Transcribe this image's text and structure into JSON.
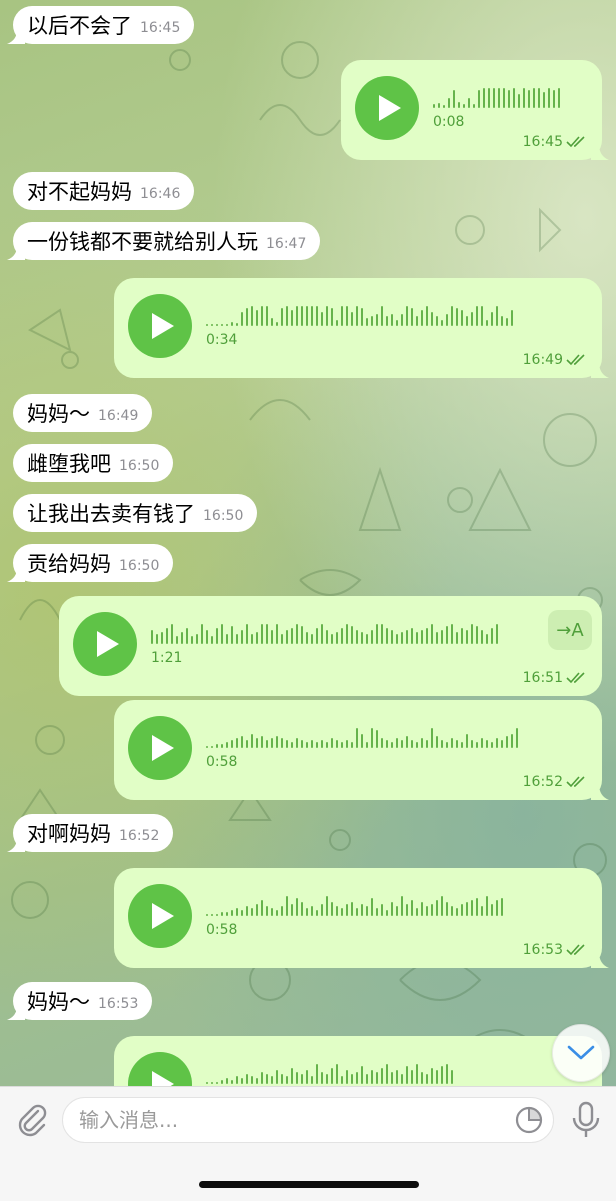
{
  "chat": {
    "incoming": [
      {
        "text": "以后不会了",
        "time": "16:45"
      },
      {
        "text": "对不起妈妈",
        "time": "16:46"
      },
      {
        "text": "一份钱都不要就给别人玩",
        "time": "16:47"
      },
      {
        "text": "妈妈～",
        "time": "16:49"
      },
      {
        "text": "雌堕我吧",
        "time": "16:50"
      },
      {
        "text": "让我出去卖有钱了",
        "time": "16:50"
      },
      {
        "text": "贡给妈妈",
        "time": "16:50"
      },
      {
        "text": "对啊妈妈",
        "time": "16:52"
      },
      {
        "text": "妈妈～",
        "time": "16:53"
      }
    ],
    "voice": [
      {
        "duration": "0:08",
        "time": "16:45"
      },
      {
        "duration": "0:34",
        "time": "16:49"
      },
      {
        "duration": "1:21",
        "time": "16:51",
        "transcribe_label": "→A"
      },
      {
        "duration": "0:58",
        "time": "16:52"
      },
      {
        "duration": "0:58",
        "time": "16:53"
      },
      {
        "duration": "",
        "time": ""
      }
    ]
  },
  "input": {
    "placeholder": "输入消息..."
  },
  "colors": {
    "accent": "#5fc347",
    "outgoing_bubble": "#e1fec6",
    "incoming_bubble": "#ffffff",
    "meta_green": "#4f9f3a"
  },
  "icons": [
    "paperclip-icon",
    "sticker-icon",
    "microphone-icon",
    "chevron-down-icon",
    "play-icon",
    "double-check-icon"
  ]
}
